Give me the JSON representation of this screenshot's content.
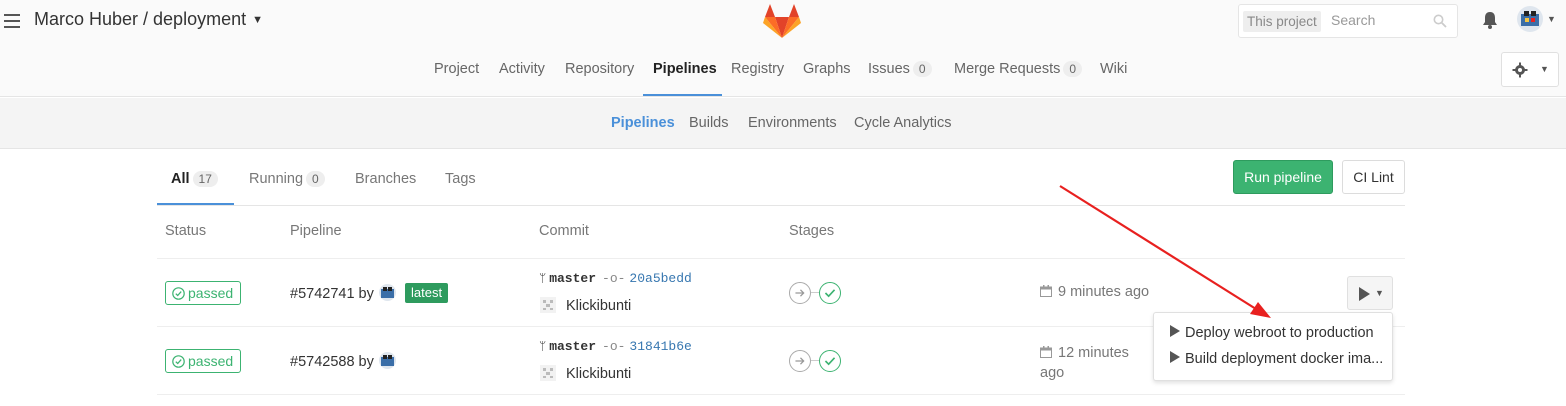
{
  "header": {
    "breadcrumb": "Marco Huber / deployment",
    "search_scope": "This project",
    "search_placeholder": "Search"
  },
  "nav": {
    "items": [
      {
        "label": "Project"
      },
      {
        "label": "Activity"
      },
      {
        "label": "Repository"
      },
      {
        "label": "Pipelines",
        "active": true
      },
      {
        "label": "Registry"
      },
      {
        "label": "Graphs"
      },
      {
        "label": "Issues",
        "count": "0"
      },
      {
        "label": "Merge Requests",
        "count": "0"
      },
      {
        "label": "Wiki"
      }
    ]
  },
  "subnav": {
    "items": [
      {
        "label": "Pipelines",
        "active": true
      },
      {
        "label": "Builds"
      },
      {
        "label": "Environments"
      },
      {
        "label": "Cycle Analytics"
      }
    ]
  },
  "tabs": [
    {
      "label": "All",
      "count": "17",
      "active": true
    },
    {
      "label": "Running",
      "count": "0"
    },
    {
      "label": "Branches"
    },
    {
      "label": "Tags"
    }
  ],
  "actions": {
    "run_pipeline": "Run pipeline",
    "ci_lint": "CI Lint"
  },
  "table": {
    "headers": [
      "Status",
      "Pipeline",
      "Commit",
      "Stages"
    ],
    "rows": [
      {
        "status": "passed",
        "pipeline_id": "#5742741",
        "by": "by",
        "tag": "latest",
        "branch": "master",
        "sha": "20a5bedd",
        "message": "Klickibunti",
        "time": "9 minutes ago"
      },
      {
        "status": "passed",
        "pipeline_id": "#5742588",
        "by": "by",
        "branch": "master",
        "sha": "31841b6e",
        "message": "Klickibunti",
        "time_line1": "12 minutes",
        "time_line2": "ago"
      }
    ]
  },
  "manual_actions_dropdown": {
    "items": [
      {
        "label": "Deploy webroot to production"
      },
      {
        "label": "Build deployment docker ima..."
      }
    ]
  },
  "colors": {
    "accent_blue": "#4a90d9",
    "success_green": "#3cb371",
    "annotation_red": "#e8201f",
    "gitlab_orange": "#fc6d26"
  }
}
